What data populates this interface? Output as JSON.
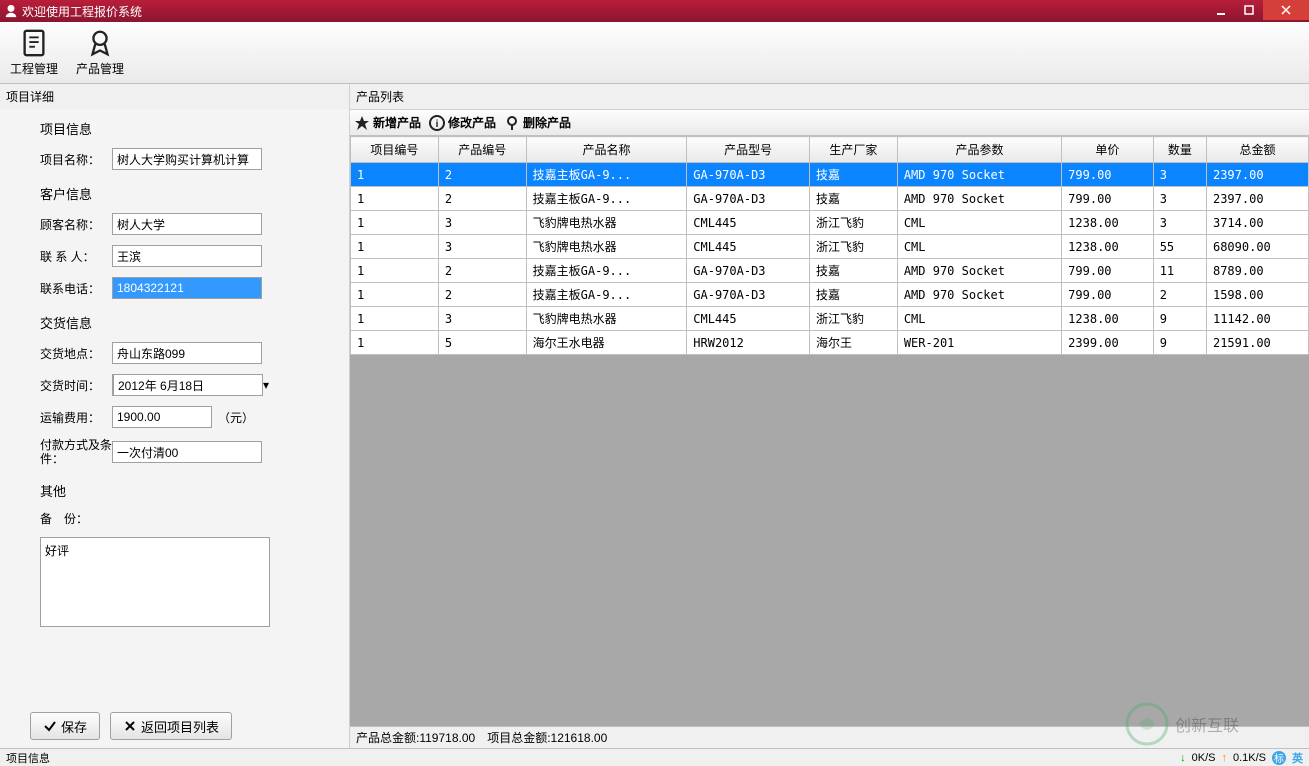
{
  "window": {
    "title": "欢迎使用工程报价系统"
  },
  "toolbar": {
    "project_mgmt": "工程管理",
    "product_mgmt": "产品管理"
  },
  "left": {
    "panel_title": "项目详细",
    "sections": {
      "project_info": "项目信息",
      "customer_info": "客户信息",
      "delivery_info": "交货信息",
      "other": "其他"
    },
    "labels": {
      "project_name": "项目名称：",
      "customer_name": "顾客名称：",
      "contact_person": "联 系 人：",
      "contact_phone": "联系电话：",
      "delivery_addr": "交货地点：",
      "delivery_time": "交货时间：",
      "shipping_fee": "运输费用：",
      "payment_terms": "付款方式及条件：",
      "remarks": "备　份："
    },
    "values": {
      "project_name": "树人大学购买计算机计算",
      "customer_name": "树人大学",
      "contact_person": "王滨",
      "contact_phone": "1804322121",
      "delivery_addr": "舟山东路099",
      "delivery_time": "2012年 6月18日",
      "shipping_fee": "1900.00",
      "shipping_unit": "（元）",
      "payment_terms": "一次付清00",
      "remarks": "好评"
    },
    "buttons": {
      "save": "保存",
      "back": "返回项目列表"
    }
  },
  "right": {
    "list_title": "产品列表",
    "actions": {
      "add": "新增产品",
      "edit": "修改产品",
      "delete": "删除产品"
    },
    "columns": [
      "项目编号",
      "产品编号",
      "产品名称",
      "产品型号",
      "生产厂家",
      "产品参数",
      "单价",
      "数量",
      "总金额"
    ],
    "rows": [
      [
        "1",
        "2",
        "技嘉主板GA-9...",
        "GA-970A-D3",
        "技嘉",
        "AMD 970 Socket",
        "799.00",
        "3",
        "2397.00"
      ],
      [
        "1",
        "2",
        "技嘉主板GA-9...",
        "GA-970A-D3",
        "技嘉",
        "AMD 970 Socket",
        "799.00",
        "3",
        "2397.00"
      ],
      [
        "1",
        "3",
        "飞豹牌电热水器",
        "CML445",
        "浙江飞豹",
        "CML",
        "1238.00",
        "3",
        "3714.00"
      ],
      [
        "1",
        "3",
        "飞豹牌电热水器",
        "CML445",
        "浙江飞豹",
        "CML",
        "1238.00",
        "55",
        "68090.00"
      ],
      [
        "1",
        "2",
        "技嘉主板GA-9...",
        "GA-970A-D3",
        "技嘉",
        "AMD 970 Socket",
        "799.00",
        "11",
        "8789.00"
      ],
      [
        "1",
        "2",
        "技嘉主板GA-9...",
        "GA-970A-D3",
        "技嘉",
        "AMD 970 Socket",
        "799.00",
        "2",
        "1598.00"
      ],
      [
        "1",
        "3",
        "飞豹牌电热水器",
        "CML445",
        "浙江飞豹",
        "CML",
        "1238.00",
        "9",
        "11142.00"
      ],
      [
        "1",
        "5",
        "海尔王水电器",
        "HRW2012",
        "海尔王",
        "WER-201",
        "2399.00",
        "9",
        "21591.00"
      ]
    ],
    "footer": {
      "product_total_label": "产品总金额:",
      "product_total": "119718.00",
      "project_total_label": "项目总金额:",
      "project_total": "121618.00"
    }
  },
  "statusbar": {
    "left": "项目信息",
    "net_down": "0K/S",
    "net_up": "0.1K/S",
    "ime1": "标",
    "ime2": "英"
  },
  "watermark": "创新互联"
}
